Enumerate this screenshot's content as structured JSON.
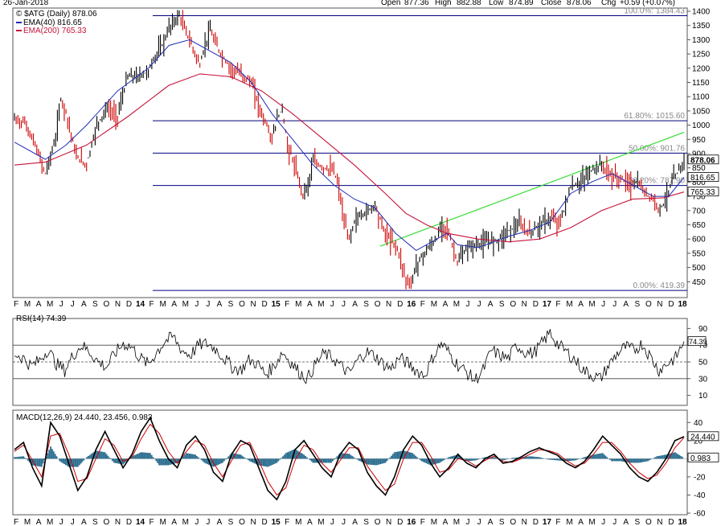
{
  "header": {
    "date": "26-Jan-2018",
    "open_label": "Open",
    "open": "877.36",
    "high_label": "High",
    "high": "882.88",
    "low_label": "Low",
    "low": "874.89",
    "close_label": "Close",
    "close": "878.06",
    "chg_label": "Chg",
    "chg": "+0.59 (+0.07%)"
  },
  "colors": {
    "price_up": "#000000",
    "price_down": "#cc0000",
    "ema40": "#1f2db8",
    "ema200": "#c8143c",
    "trendline": "#33dd33",
    "fib": "#000080",
    "macd_hist": "#2a6d8f",
    "rsi_fill": "#3c6e3c"
  },
  "chart_data": [
    {
      "type": "line",
      "name": "price",
      "title": "$ATG (Daily) 878.06",
      "legend": [
        {
          "label": "EMA(40) 816.65"
        },
        {
          "label": "EMA(200) 765.33"
        }
      ],
      "ylim": [
        400,
        1400
      ],
      "y_ticks": [
        450,
        500,
        550,
        600,
        650,
        700,
        750,
        800,
        850,
        900,
        950,
        1000,
        1050,
        1100,
        1150,
        1200,
        1250,
        1300,
        1350,
        1400
      ],
      "x_tick_labels": [
        "F",
        "M",
        "A",
        "M",
        "J",
        "J",
        "A",
        "S",
        "O",
        "N",
        "D",
        "14",
        "F",
        "M",
        "A",
        "M",
        "J",
        "J",
        "A",
        "S",
        "O",
        "N",
        "D",
        "15",
        "F",
        "M",
        "A",
        "M",
        "J",
        "J",
        "A",
        "S",
        "O",
        "N",
        "D",
        "16",
        "F",
        "M",
        "A",
        "M",
        "J",
        "J",
        "A",
        "S",
        "O",
        "N",
        "D",
        "17",
        "F",
        "M",
        "A",
        "M",
        "J",
        "J",
        "A",
        "S",
        "O",
        "N",
        "D",
        "18"
      ],
      "price_tags": [
        "878.06",
        "816.65",
        "765.33"
      ],
      "fib_levels": [
        {
          "label": "100.0%: 1384.43",
          "value": 1384.43
        },
        {
          "label": "61.80%: 1015.60",
          "value": 1015.6
        },
        {
          "label": "50.00%: 901.76",
          "value": 901.76
        },
        {
          "label": "38.20%: 787.90",
          "value": 787.9
        },
        {
          "label": "0.00%: 419.39",
          "value": 419.39
        }
      ],
      "series": [
        {
          "name": "$ATG",
          "points": [
            [
              0,
              1020
            ],
            [
              2,
              1010
            ],
            [
              4,
              930
            ],
            [
              6,
              830
            ],
            [
              8,
              950
            ],
            [
              9,
              1090
            ],
            [
              10,
              1050
            ],
            [
              12,
              890
            ],
            [
              14,
              860
            ],
            [
              16,
              1000
            ],
            [
              18,
              1060
            ],
            [
              20,
              1030
            ],
            [
              22,
              1170
            ],
            [
              24,
              1170
            ],
            [
              26,
              1190
            ],
            [
              27,
              1230
            ],
            [
              29,
              1290
            ],
            [
              30,
              1340
            ],
            [
              32,
              1385
            ],
            [
              34,
              1300
            ],
            [
              36,
              1210
            ],
            [
              37,
              1280
            ],
            [
              38,
              1330
            ],
            [
              39,
              1290
            ],
            [
              40,
              1250
            ],
            [
              42,
              1200
            ],
            [
              44,
              1180
            ],
            [
              46,
              1150
            ],
            [
              48,
              1040
            ],
            [
              49,
              1000
            ],
            [
              50,
              950
            ],
            [
              51,
              1020
            ],
            [
              52,
              1060
            ],
            [
              53,
              930
            ],
            [
              54,
              880
            ],
            [
              55,
              820
            ],
            [
              56,
              760
            ],
            [
              57,
              790
            ],
            [
              58,
              870
            ],
            [
              60,
              850
            ],
            [
              62,
              840
            ],
            [
              63,
              780
            ],
            [
              64,
              660
            ],
            [
              65,
              600
            ],
            [
              66,
              660
            ],
            [
              67,
              680
            ],
            [
              68,
              690
            ],
            [
              70,
              720
            ],
            [
              72,
              620
            ],
            [
              74,
              580
            ],
            [
              75,
              530
            ],
            [
              76,
              460
            ],
            [
              77,
              440
            ],
            [
              78,
              510
            ],
            [
              80,
              560
            ],
            [
              82,
              600
            ],
            [
              83,
              650
            ],
            [
              84,
              640
            ],
            [
              86,
              520
            ],
            [
              87,
              540
            ],
            [
              88,
              570
            ],
            [
              90,
              580
            ],
            [
              92,
              590
            ],
            [
              94,
              600
            ],
            [
              96,
              630
            ],
            [
              98,
              650
            ],
            [
              100,
              620
            ],
            [
              102,
              650
            ],
            [
              104,
              670
            ],
            [
              106,
              660
            ],
            [
              107,
              720
            ],
            [
              108,
              780
            ],
            [
              110,
              800
            ],
            [
              112,
              840
            ],
            [
              114,
              860
            ],
            [
              116,
              820
            ],
            [
              118,
              810
            ],
            [
              120,
              790
            ],
            [
              121,
              800
            ],
            [
              122,
              770
            ],
            [
              124,
              740
            ],
            [
              125,
              710
            ],
            [
              126,
              720
            ],
            [
              127,
              770
            ],
            [
              128,
              810
            ],
            [
              129,
              840
            ],
            [
              130,
              878
            ]
          ]
        },
        {
          "name": "EMA(40)",
          "points": [
            [
              0,
              940
            ],
            [
              6,
              880
            ],
            [
              10,
              930
            ],
            [
              14,
              1000
            ],
            [
              20,
              1120
            ],
            [
              26,
              1200
            ],
            [
              30,
              1280
            ],
            [
              34,
              1300
            ],
            [
              38,
              1260
            ],
            [
              42,
              1220
            ],
            [
              46,
              1150
            ],
            [
              50,
              1040
            ],
            [
              54,
              950
            ],
            [
              58,
              860
            ],
            [
              62,
              790
            ],
            [
              66,
              740
            ],
            [
              70,
              710
            ],
            [
              74,
              620
            ],
            [
              76,
              590
            ],
            [
              78,
              560
            ],
            [
              80,
              580
            ],
            [
              84,
              620
            ],
            [
              86,
              580
            ],
            [
              90,
              570
            ],
            [
              96,
              610
            ],
            [
              100,
              630
            ],
            [
              104,
              660
            ],
            [
              108,
              760
            ],
            [
              112,
              800
            ],
            [
              116,
              830
            ],
            [
              120,
              790
            ],
            [
              124,
              750
            ],
            [
              127,
              750
            ],
            [
              130,
              816.65
            ]
          ]
        },
        {
          "name": "EMA(200)",
          "points": [
            [
              0,
              860
            ],
            [
              6,
              870
            ],
            [
              14,
              930
            ],
            [
              22,
              1030
            ],
            [
              30,
              1140
            ],
            [
              36,
              1180
            ],
            [
              42,
              1170
            ],
            [
              48,
              1120
            ],
            [
              54,
              1040
            ],
            [
              60,
              950
            ],
            [
              66,
              860
            ],
            [
              72,
              760
            ],
            [
              76,
              690
            ],
            [
              80,
              650
            ],
            [
              84,
              620
            ],
            [
              90,
              600
            ],
            [
              96,
              590
            ],
            [
              102,
              600
            ],
            [
              108,
              640
            ],
            [
              114,
              700
            ],
            [
              120,
              740
            ],
            [
              126,
              745
            ],
            [
              130,
              765.33
            ]
          ]
        }
      ]
    },
    {
      "type": "line",
      "name": "rsi",
      "title": "RSI(14) 74.39",
      "ylim": [
        0,
        100
      ],
      "y_ticks": [
        10,
        30,
        50,
        70,
        90
      ],
      "reference_lines": [
        70,
        50,
        30
      ],
      "value_tag": "74.39",
      "values": [
        60,
        55,
        45,
        52,
        65,
        48,
        40,
        58,
        70,
        62,
        50,
        44,
        60,
        72,
        68,
        55,
        47,
        62,
        75,
        80,
        64,
        58,
        70,
        72,
        66,
        55,
        44,
        40,
        52,
        48,
        35,
        45,
        62,
        50,
        38,
        30,
        48,
        60,
        55,
        45,
        36,
        52,
        62,
        58,
        48,
        42,
        55,
        48,
        40,
        34,
        56,
        72,
        60,
        46,
        38,
        28,
        40,
        64,
        58,
        54,
        70,
        62,
        60,
        72,
        85,
        70,
        62,
        52,
        40,
        34,
        30,
        46,
        60,
        68,
        64,
        72,
        56,
        40,
        48,
        55,
        74.39
      ]
    },
    {
      "type": "line",
      "name": "macd",
      "title": "MACD(12,26,9) 24.440, 23.456, 0.983",
      "ylim": [
        -60,
        50
      ],
      "y_ticks": [
        -60,
        -40,
        -20,
        0,
        20,
        40
      ],
      "value_tags": [
        "24.440",
        "0.983"
      ],
      "macd": [
        10,
        18,
        -10,
        -30,
        40,
        25,
        -5,
        -35,
        -20,
        10,
        30,
        10,
        -10,
        5,
        30,
        45,
        20,
        0,
        -10,
        15,
        25,
        10,
        -15,
        -25,
        5,
        20,
        15,
        -10,
        -35,
        -45,
        -25,
        10,
        20,
        5,
        -10,
        -20,
        5,
        18,
        10,
        -15,
        -30,
        -40,
        -20,
        10,
        25,
        15,
        -5,
        -20,
        -10,
        5,
        -5,
        -10,
        0,
        5,
        -5,
        -3,
        2,
        8,
        12,
        8,
        4,
        -5,
        -10,
        -3,
        10,
        25,
        15,
        5,
        -10,
        -20,
        -25,
        -15,
        0,
        20,
        24.44
      ],
      "signal": [
        8,
        15,
        -2,
        -20,
        25,
        28,
        5,
        -25,
        -22,
        0,
        22,
        15,
        -3,
        2,
        22,
        38,
        28,
        8,
        -5,
        8,
        20,
        15,
        -5,
        -20,
        -2,
        15,
        18,
        -2,
        -25,
        -40,
        -32,
        -2,
        15,
        10,
        -5,
        -15,
        -2,
        12,
        12,
        -8,
        -22,
        -35,
        -28,
        0,
        18,
        18,
        3,
        -15,
        -12,
        0,
        -2,
        -8,
        -2,
        3,
        -3,
        -4,
        0,
        5,
        10,
        9,
        6,
        -2,
        -8,
        -5,
        5,
        18,
        18,
        8,
        -5,
        -15,
        -22,
        -18,
        -5,
        12,
        23.456
      ]
    }
  ]
}
